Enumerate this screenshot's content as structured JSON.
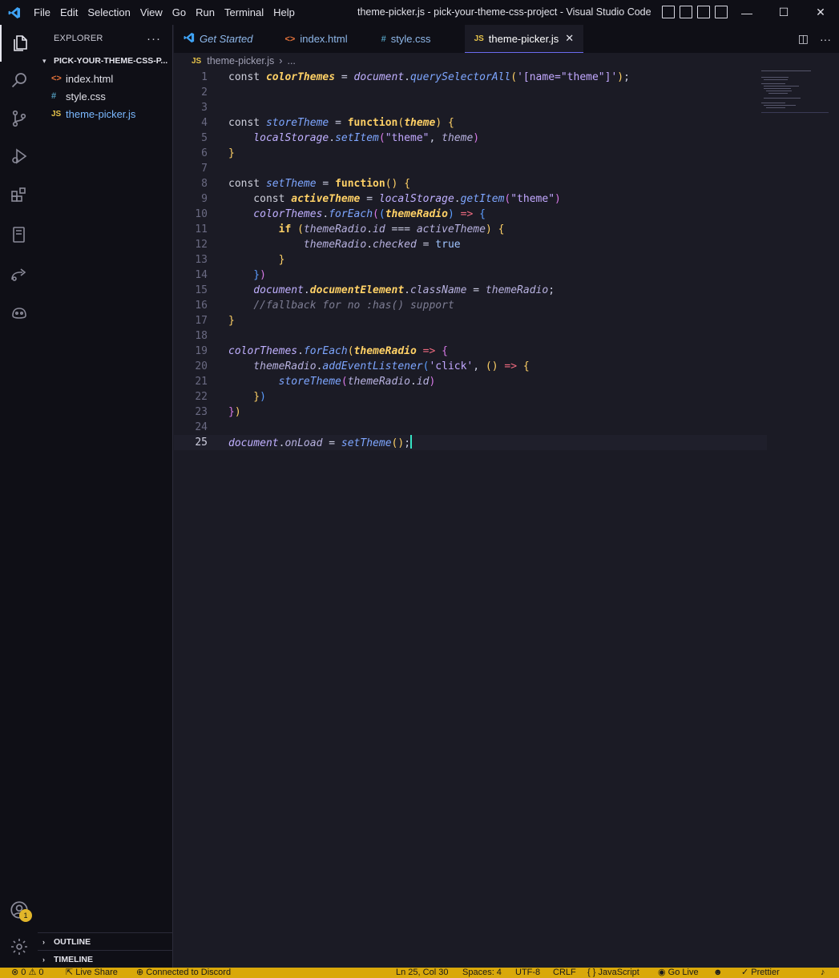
{
  "titlebar": {
    "menus": [
      "File",
      "Edit",
      "Selection",
      "View",
      "Go",
      "Run",
      "Terminal",
      "Help"
    ],
    "title": "theme-picker.js - pick-your-theme-css-project - Visual Studio Code",
    "minimize": "—",
    "maximize": "☐",
    "close": "✕"
  },
  "activity": {
    "icons": [
      "files-icon",
      "search-icon",
      "source-control-icon",
      "run-debug-icon",
      "extensions-icon",
      "remote-explorer-icon",
      "live-share-icon",
      "copilot-icon"
    ],
    "account_badge": "1"
  },
  "sidebar": {
    "header": "EXPLORER",
    "more": "···",
    "folder": "PICK-YOUR-THEME-CSS-P...",
    "files": [
      {
        "icon": "<>",
        "name": "index.html",
        "color": "#e8743b"
      },
      {
        "icon": "#",
        "name": "style.css",
        "color": "#519aba"
      },
      {
        "icon": "JS",
        "name": "theme-picker.js",
        "color": "#e6c34a"
      }
    ],
    "outline": "OUTLINE",
    "timeline": "TIMELINE"
  },
  "tabs": [
    {
      "icon": "⊲",
      "label": "Get Started"
    },
    {
      "icon": "<>",
      "label": "index.html"
    },
    {
      "icon": "#",
      "label": "style.css"
    },
    {
      "icon": "JS",
      "label": "theme-picker.js",
      "close": "✕"
    }
  ],
  "tab_actions": {
    "split": "◫",
    "more": "···"
  },
  "breadcrumb": {
    "icon": "JS",
    "file": "theme-picker.js",
    "sep": "›",
    "rest": "..."
  },
  "editor": {
    "line_numbers": [
      "1",
      "2",
      "3",
      "4",
      "5",
      "6",
      "7",
      "8",
      "9",
      "10",
      "11",
      "12",
      "13",
      "14",
      "15",
      "16",
      "17",
      "18",
      "19",
      "20",
      "21",
      "22",
      "23",
      "24",
      "25"
    ],
    "current_line": 25,
    "comment": "//fallback for no :has() support"
  },
  "statusbar": {
    "problems": "⊗ 0 ⚠ 0",
    "live_share": "Live Share",
    "discord": "Connected to Discord",
    "position": "Ln 25, Col 30",
    "spaces": "Spaces: 4",
    "encoding": "UTF-8",
    "eol": "CRLF",
    "language": "{ } JavaScript",
    "go_live": "Go Live",
    "prettier": "✓ Prettier"
  },
  "colors": {
    "bg": "#1b1b25",
    "chrome": "#0f0f16",
    "statusbar": "#d9a80a",
    "accent": "#6a6af0"
  }
}
